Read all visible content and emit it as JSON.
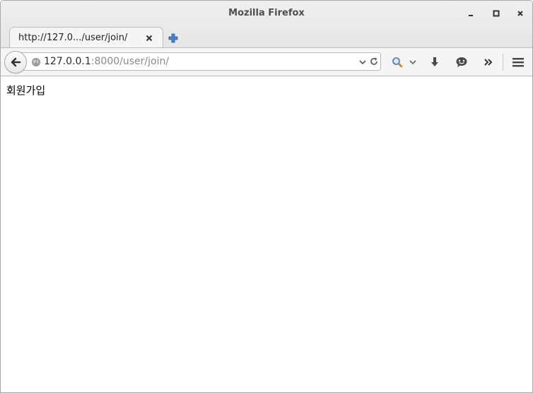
{
  "window": {
    "title": "Mozilla Firefox"
  },
  "tabs": [
    {
      "label": "http://127.0.../user/join/",
      "active": true
    }
  ],
  "urlbar": {
    "host": "127.0.0.1",
    "rest": ":8000/user/join/"
  },
  "page": {
    "heading": "회원가입"
  },
  "icons": {
    "back": "back-arrow-icon",
    "globe": "globe-icon",
    "search": "search-icon",
    "download": "download-icon",
    "chat": "chat-icon",
    "overflow": "chevron-double-right-icon",
    "menu": "hamburger-menu-icon"
  },
  "colors": {
    "url_host": "#2b2b2b",
    "url_rest": "#8a8a8a",
    "chrome": "#f5f5f5"
  }
}
